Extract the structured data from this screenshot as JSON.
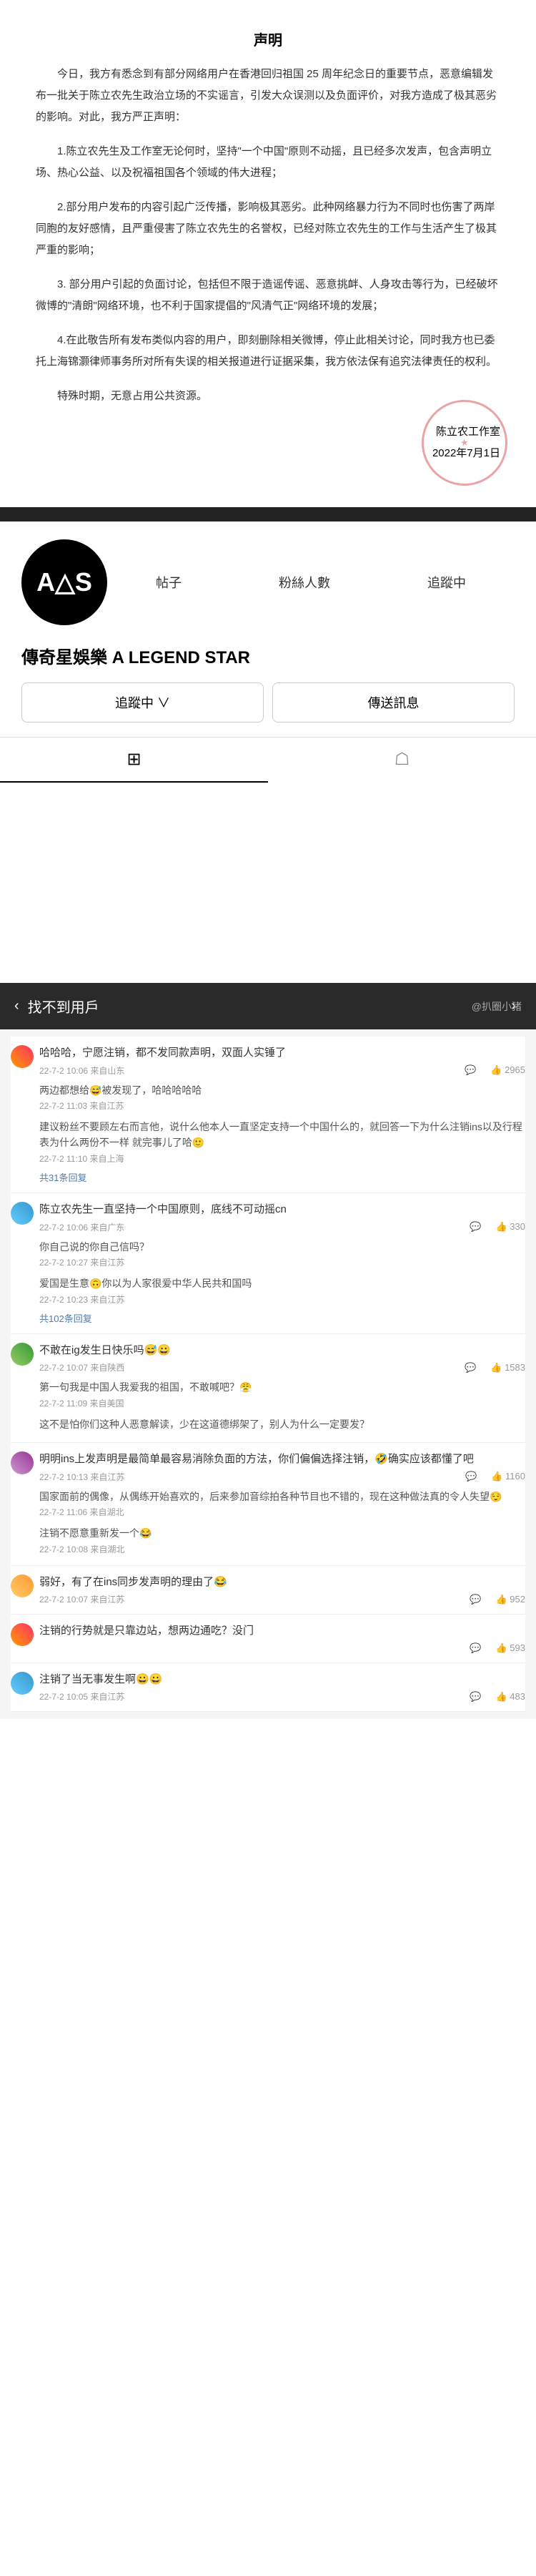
{
  "statement": {
    "title": "声明",
    "intro": "今日，我方有悉念到有部分网络用户在香港回归祖国 25 周年纪念日的重要节点，恶意编辑发布一批关于陈立农先生政治立场的不实谣言，引发大众误测以及负面评价，对我方造成了极其恶劣的影响。对此，我方严正声明：",
    "p1": "1.陈立农先生及工作室无论何时，坚持\"一个中国\"原则不动摇，且已经多次发声，包含声明立场、热心公益、以及祝福祖国各个领域的伟大进程；",
    "p2": "2.部分用户发布的内容引起广泛传播，影响极其恶劣。此种网络暴力行为不同时也伤害了两岸同胞的友好感情，且严重侵害了陈立农先生的名誉权，已经对陈立农先生的工作与生活产生了极其严重的影响；",
    "p3": "3. 部分用户引起的负面讨论，包括但不限于造谣传谣、恶意挑衅、人身攻击等行为，已经破坏微博的\"清朗\"网络环境，也不利于国家提倡的\"风清气正\"网络环境的发展；",
    "p4": "4.在此敬告所有发布类似内容的用户，即刻删除相关微博，停止此相关讨论，同时我方也已委托上海锦灏律师事务所对所有失误的相关报道进行证据采集，我方依法保有追究法律责任的权利。",
    "closing": "特殊时期，无意占用公共资源。",
    "signature": "陈立农工作室",
    "date": "2022年7月1日"
  },
  "profile": {
    "name": "傳奇星娛樂 A LEGEND STAR",
    "stat_posts": "帖子",
    "stat_followers": "粉絲人數",
    "stat_following": "追蹤中",
    "follow_btn": "追蹤中 ∨",
    "message_btn": "傳送訊息",
    "avatar_text": "A△S"
  },
  "notfound": {
    "text": "找不到用戶",
    "back": "‹",
    "watermark": "@扒圈小猪"
  },
  "comments": [
    {
      "name": "",
      "text": "哈哈哈，宁愿注销，都不发同款声明，双面人实锤了",
      "meta": "22-7-2 10:06 来自山东",
      "likes": "2965",
      "reply": {
        "text": "两边都想给😅被发现了，哈哈哈哈哈",
        "meta": "22-7-2 11:03 来自江苏"
      },
      "reply2": {
        "text": "建议粉丝不要顾左右而言他，说什么他本人一直坚定支持一个中国什么的，就回答一下为什么注销ins以及行程表为什么两份不一样 就完事儿了哈🙂",
        "meta": "22-7-2 11:10 来自上海"
      },
      "reply_link": "共31条回复"
    },
    {
      "name": "",
      "text": "陈立农先生一直坚持一个中国原则，底线不可动摇cn",
      "meta": "22-7-2 10:06 来自广东",
      "likes": "330",
      "reply": {
        "text": "你自己说的你自己信吗？",
        "meta": "22-7-2 10:27 来自江苏"
      },
      "reply2": {
        "text": "爱国是生意🙃你以为人家很爱中华人民共和国吗",
        "meta": "22-7-2 10:23 来自江苏"
      },
      "reply_link": "共102条回复"
    },
    {
      "name": "",
      "text": "不敢在ig发生日快乐吗😅😀",
      "meta": "22-7-2 10:07 来自陕西",
      "likes": "1583",
      "reply": {
        "text": "第一句我是中国人我爱我的祖国，不敢喊吧？😤",
        "meta": "22-7-2 11:09 来自美国"
      },
      "reply2": {
        "text": "这不是怕你们这种人恶意解读，少在这道德绑架了，别人为什么一定要发？",
        "meta": ""
      }
    },
    {
      "name": "",
      "text": "明明ins上发声明是最简单最容易消除负面的方法，你们偏偏选择注销，🤣确实应该都懂了吧",
      "meta": "22-7-2 10:13 来自江苏",
      "likes": "1160",
      "reply": {
        "text": "国家面前的偶像，从偶练开始喜欢的，后来参加音综拍各种节目也不错的，现在这种做法真的令人失望😌",
        "meta": "22-7-2 11:06 来自湖北"
      },
      "reply2": {
        "text": "注销不愿意重新发一个😂",
        "meta": "22-7-2 10:08 来自湖北"
      }
    },
    {
      "name": "",
      "text": "弱好，有了在ins同步发声明的理由了😂",
      "meta": "22-7-2 10:07 来自江苏",
      "likes": "952"
    },
    {
      "name": "",
      "text": "注销的行势就是只靠边站，想两边通吃？没门",
      "meta": "",
      "likes": "593"
    },
    {
      "name": "",
      "text": "注销了当无事发生啊😀😀",
      "meta": "22-7-2 10:05 来自江苏",
      "likes": "483"
    }
  ]
}
